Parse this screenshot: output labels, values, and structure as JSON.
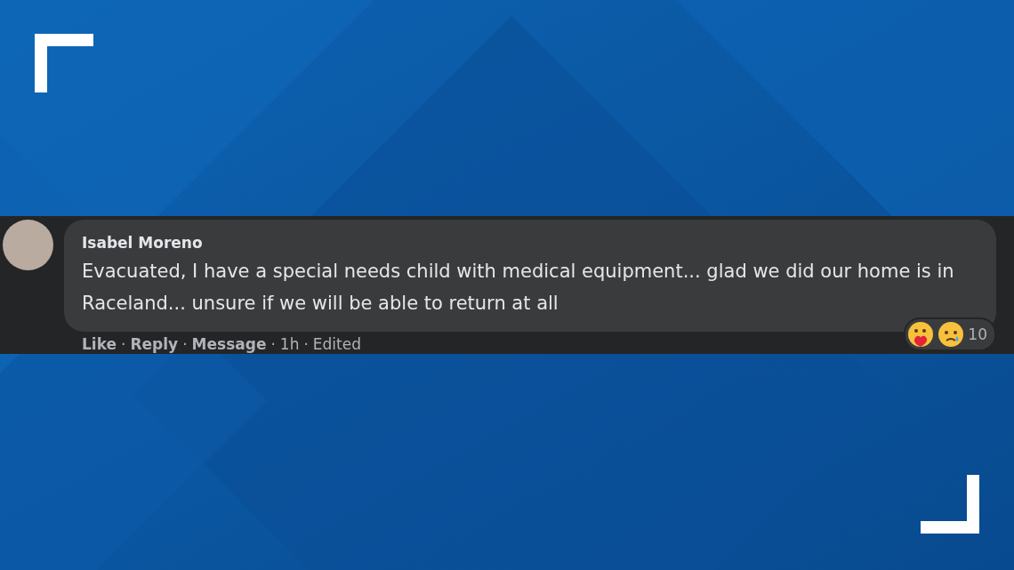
{
  "comment": {
    "author": "Isabel Moreno",
    "text": "Evacuated, I have a special needs child with medical equipment... glad we did our home is in Raceland... unsure if we will be able to return at all",
    "actions": [
      "Like",
      "Reply",
      "Message"
    ],
    "separator": "·",
    "time": "1h",
    "edited": "Edited",
    "reactions": {
      "count": "10"
    }
  }
}
